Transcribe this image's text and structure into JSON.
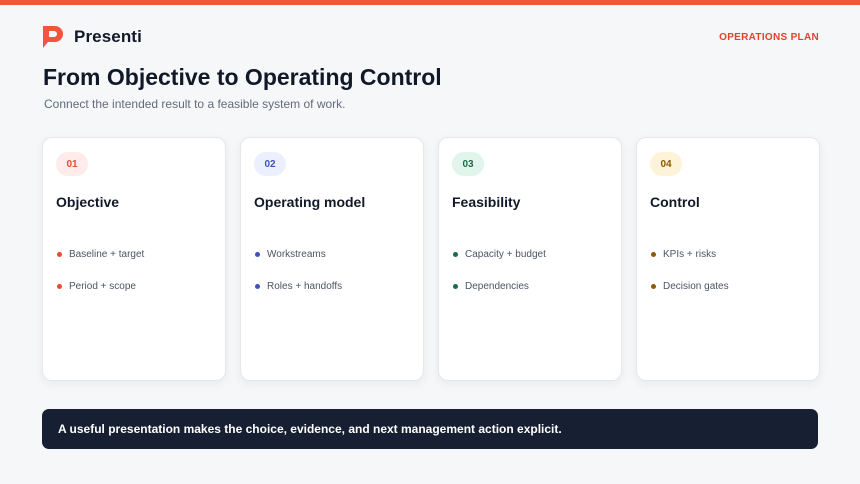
{
  "brand": {
    "name": "Presenti",
    "logo_icon": "presenti-p-logo-icon",
    "accent_color": "#f2553d"
  },
  "header": {
    "section_label": "OPERATIONS PLAN"
  },
  "slide": {
    "title": "From Objective to Operating Control",
    "subtitle": "Connect the intended result to a feasible system of work."
  },
  "cards": [
    {
      "number": "01",
      "title": "Objective",
      "badge_bg": "#fdecea",
      "accent": "#e54b35",
      "bullets": [
        "Baseline + target",
        "Period + scope"
      ]
    },
    {
      "number": "02",
      "title": "Operating model",
      "badge_bg": "#eceffd",
      "accent": "#4050c0",
      "bullets": [
        "Workstreams",
        "Roles + handoffs"
      ]
    },
    {
      "number": "03",
      "title": "Feasibility",
      "badge_bg": "#e2f5ec",
      "accent": "#1a6b48",
      "bullets": [
        "Capacity + budget",
        "Dependencies"
      ]
    },
    {
      "number": "04",
      "title": "Control",
      "badge_bg": "#fdf3d9",
      "accent": "#8a5a0a",
      "bullets": [
        "KPIs + risks",
        "Decision gates"
      ]
    }
  ],
  "callout": {
    "text": "A useful presentation makes the choice, evidence, and next management action explicit."
  }
}
